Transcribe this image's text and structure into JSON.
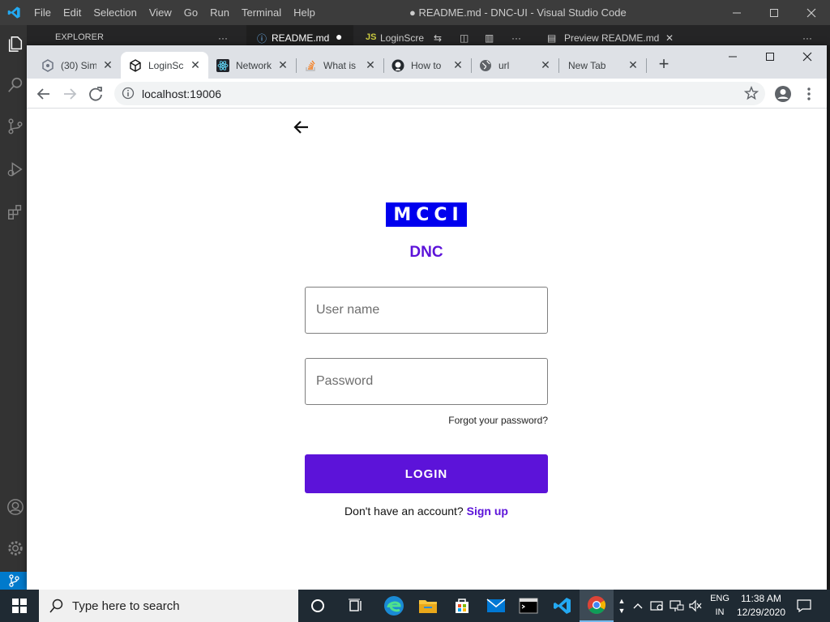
{
  "vscode": {
    "menu": [
      "File",
      "Edit",
      "Selection",
      "View",
      "Go",
      "Run",
      "Terminal",
      "Help"
    ],
    "window_title": "● README.md - DNC-UI - Visual Studio Code",
    "tabs": {
      "explorer": "EXPLORER",
      "readme": "README.md",
      "loginscreen": "LoginScre",
      "preview": "Preview README.md"
    }
  },
  "chrome": {
    "tabs": [
      {
        "label": "(30) Sim",
        "icon": "extension-icon"
      },
      {
        "label": "LoginSc",
        "icon": "codesandbox-icon"
      },
      {
        "label": "Network",
        "icon": "react-icon"
      },
      {
        "label": "What is",
        "icon": "stackoverflow-icon"
      },
      {
        "label": "How to",
        "icon": "github-icon"
      },
      {
        "label": "url",
        "icon": "globe-icon"
      },
      {
        "label": "New Tab",
        "icon": ""
      }
    ],
    "url": "localhost:19006"
  },
  "login": {
    "logo_text": "MCCI",
    "app_title": "DNC",
    "username_placeholder": "User name",
    "password_placeholder": "Password",
    "forgot_label": "Forgot your password?",
    "login_label": "LOGIN",
    "signup_prompt": "Don't have an account? ",
    "signup_link": "Sign up",
    "accent_color": "#5c13d9",
    "logo_color": "#0000ee"
  },
  "taskbar": {
    "search_placeholder": "Type here to search",
    "lang_top": "ENG",
    "lang_bottom": "IN",
    "time": "11:38 AM",
    "date": "12/29/2020"
  }
}
